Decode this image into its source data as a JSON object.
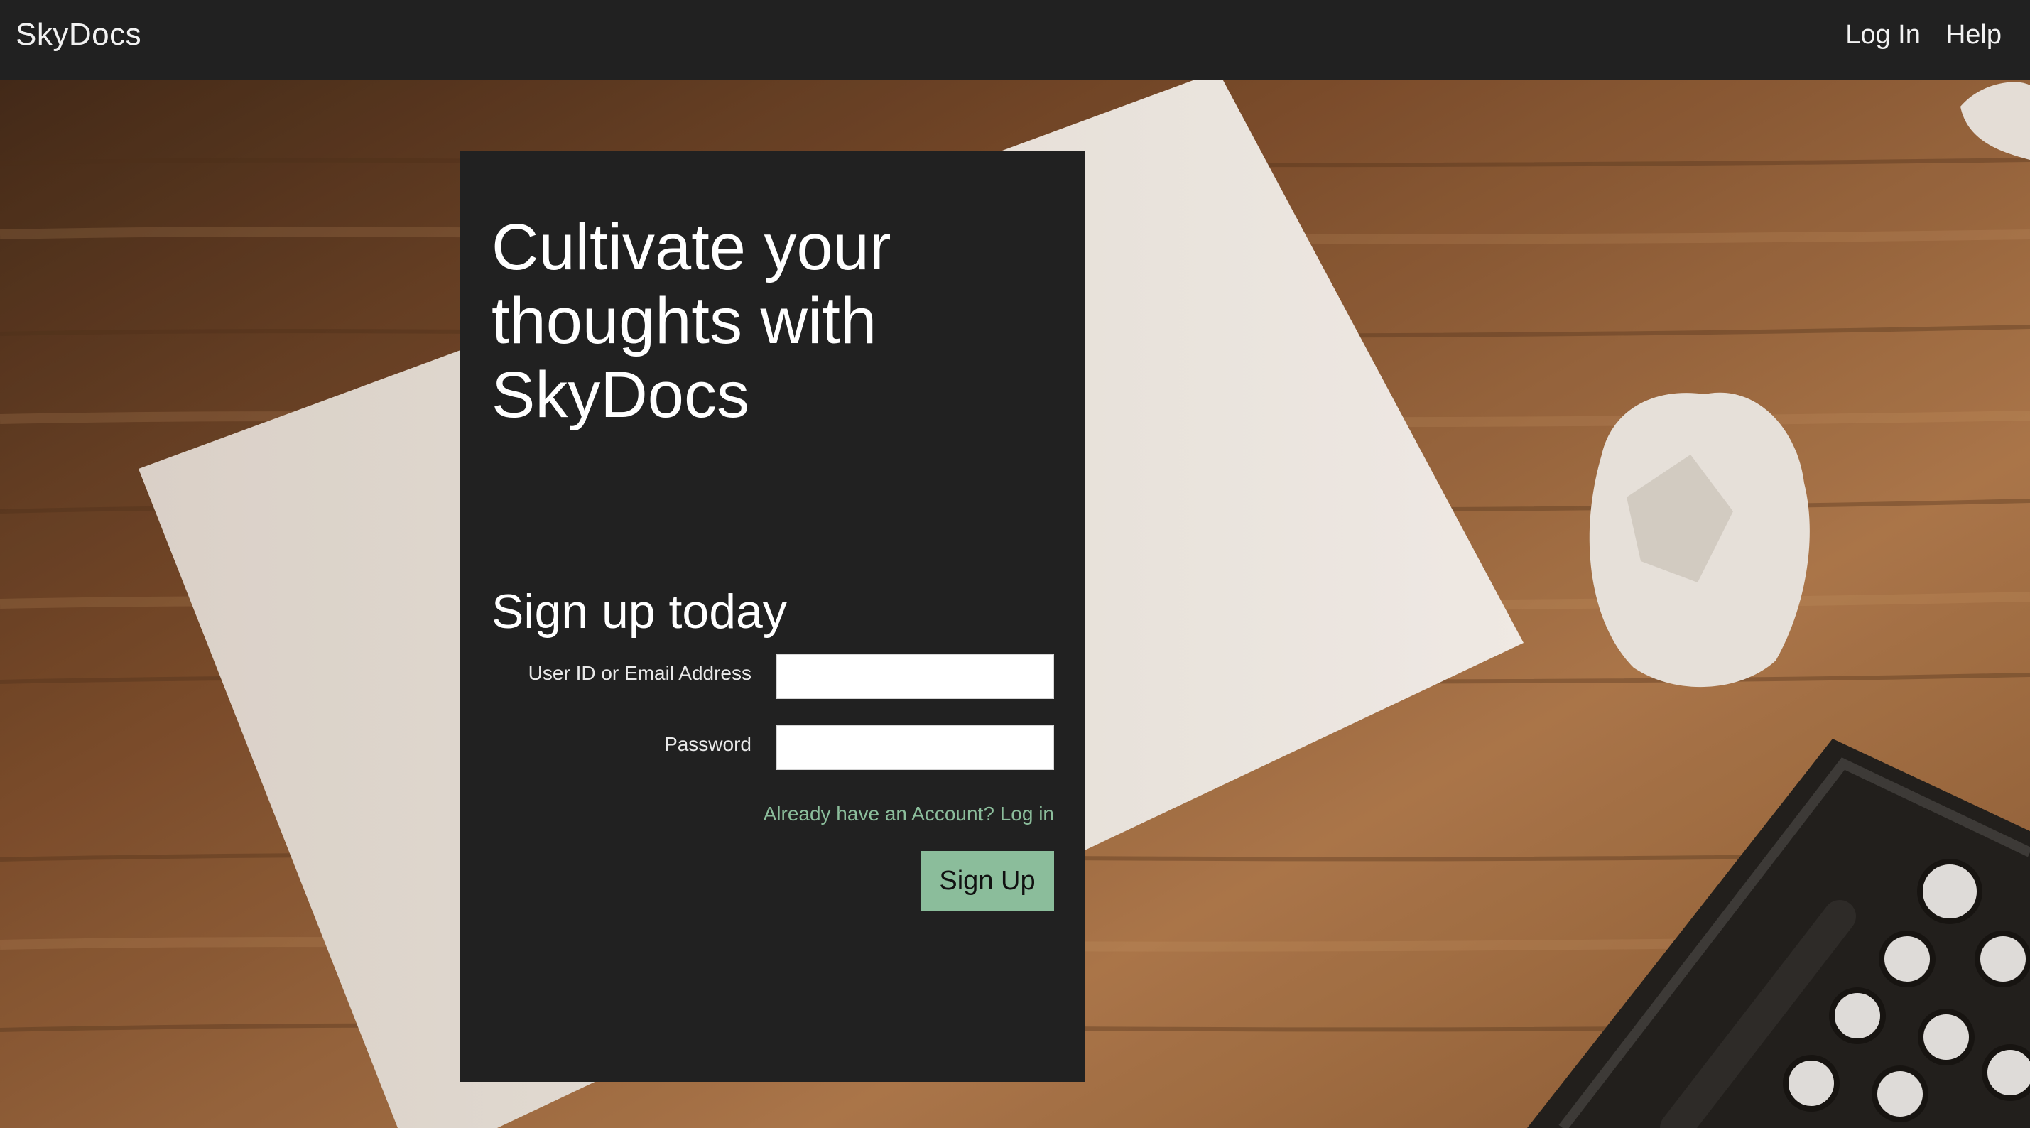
{
  "nav": {
    "brand": "SkyDocs",
    "links": [
      "Log In",
      "Help"
    ]
  },
  "hero": {
    "headline": "Cultivate your thoughts with SkyDocs"
  },
  "signup": {
    "heading": "Sign up today",
    "user_label": "User ID or Email Address",
    "user_value": "",
    "password_label": "Password",
    "password_value": "",
    "login_link": "Already have an Account? Log in",
    "submit_label": "Sign Up"
  },
  "colors": {
    "nav_bg": "#212121",
    "card_bg": "#212121",
    "accent": "#8bbd9b",
    "text": "#ffffff"
  }
}
